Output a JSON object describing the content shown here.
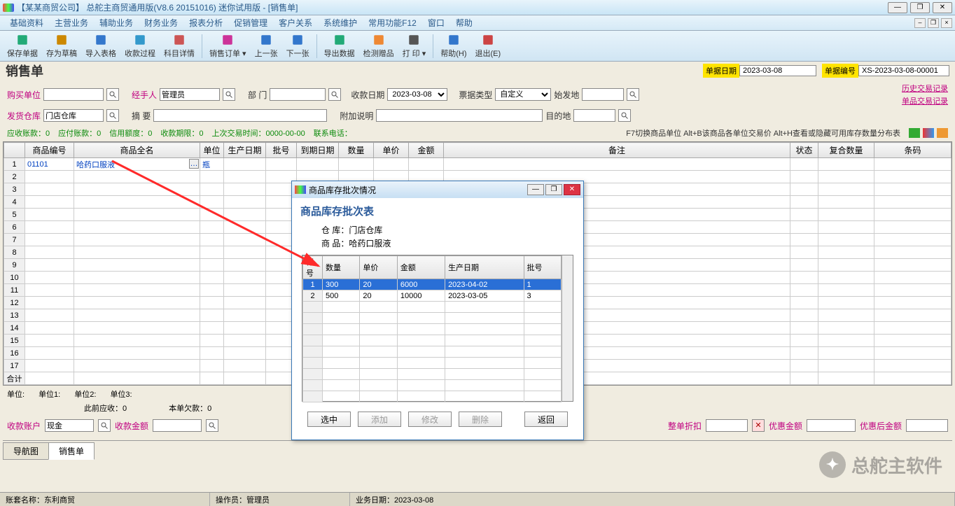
{
  "window": {
    "title": "【某某商贸公司】 总舵主商贸通用版(V8.6 20151016) 迷你试用版 - [销售单]"
  },
  "menu": [
    "基础资料",
    "主营业务",
    "辅助业务",
    "财务业务",
    "报表分析",
    "促销管理",
    "客户关系",
    "系统维护",
    "常用功能F12",
    "窗口",
    "帮助"
  ],
  "toolbar": [
    {
      "k": "save",
      "l": "保存单据"
    },
    {
      "k": "draft",
      "l": "存为草稿"
    },
    {
      "k": "import",
      "l": "导入表格"
    },
    {
      "k": "recv",
      "l": "收款过程"
    },
    {
      "k": "detail",
      "l": "科目详情"
    },
    {
      "sep": true
    },
    {
      "k": "order",
      "l": "销售订单",
      "drop": true
    },
    {
      "k": "prev",
      "l": "上一张"
    },
    {
      "k": "next",
      "l": "下一张"
    },
    {
      "sep": true
    },
    {
      "k": "export",
      "l": "导出数据"
    },
    {
      "k": "gift",
      "l": "检测赠品"
    },
    {
      "k": "print",
      "l": "打 印",
      "drop": true
    },
    {
      "sep": true
    },
    {
      "k": "help",
      "l": "帮助(H)"
    },
    {
      "k": "exit",
      "l": "退出(E)"
    }
  ],
  "header": {
    "title": "销售单",
    "dateLbl": "单据日期",
    "date": "2023-03-08",
    "noLbl": "单据编号",
    "no": "XS-2023-03-08-00001"
  },
  "form": {
    "buyer": "购买单位",
    "handler": "经手人",
    "handlerVal": "管理员",
    "dept": "部 门",
    "recvDate": "收款日期",
    "recvDateVal": "2023-03-08",
    "billType": "票据类型",
    "billTypeVal": "自定义",
    "origin": "始发地",
    "warehouse": "发货仓库",
    "warehouseVal": "门店仓库",
    "summary": "摘 要",
    "extra": "附加说明",
    "dest": "目的地",
    "linkHistory": "历史交易记录",
    "linkSingle": "单品交易记录"
  },
  "status": {
    "ar": "应收账款：0",
    "ap": "应付账款：0",
    "credit": "信用额度：0",
    "due": "收款期限：0",
    "last": "上次交易时间：0000-00-00",
    "tel": "联系电话：",
    "tips": "F7切换商品单位  Alt+B该商品各单位交易价  Alt+H查看或隐藏可用库存数量分布表"
  },
  "gridHeaders": [
    "",
    "商品编号",
    "商品全名",
    "单位",
    "生产日期",
    "批号",
    "到期日期",
    "数量",
    "单价",
    "金额",
    "备注",
    "状态",
    "复合数量",
    "条码"
  ],
  "gridRow1": {
    "no": "1",
    "code": "01101",
    "name": "哈药口服液",
    "unit": "瓶"
  },
  "sumRow": "合计",
  "unitsRow": {
    "u": "单位:",
    "u1": "单位1:",
    "u2": "单位2:",
    "u3": "单位3:"
  },
  "beforeRecv": "此前应收：0",
  "thisOwe": "本单欠款：0",
  "bottom": {
    "acct": "收款账户",
    "acctVal": "现金",
    "amt": "收款金额",
    "disc": "整单折扣",
    "discAmt": "优惠金额",
    "after": "优惠后金额"
  },
  "tabs": [
    "导航图",
    "销售单"
  ],
  "sb": {
    "acct": "账套名称：东利商贸",
    "op": "操作员：管理员",
    "biz": "业务日期：2023-03-08"
  },
  "dialog": {
    "title": "商品库存批次情况",
    "heading": "商品库存批次表",
    "whLbl": "仓  库：",
    "wh": "门店仓库",
    "pdLbl": "商  品：",
    "pd": "哈药口服液",
    "cols": [
      "行号",
      "数量",
      "单价",
      "金额",
      "生产日期",
      "批号"
    ],
    "rows": [
      {
        "n": "1",
        "qty": "300",
        "price": "20",
        "amt": "6000",
        "date": "2023-04-02",
        "batch": "1",
        "sel": true
      },
      {
        "n": "2",
        "qty": "500",
        "price": "20",
        "amt": "10000",
        "date": "2023-03-05",
        "batch": "3"
      }
    ],
    "btns": {
      "pick": "选中",
      "add": "添加",
      "edit": "修改",
      "del": "删除",
      "back": "返回"
    }
  },
  "watermark": "总舵主软件"
}
